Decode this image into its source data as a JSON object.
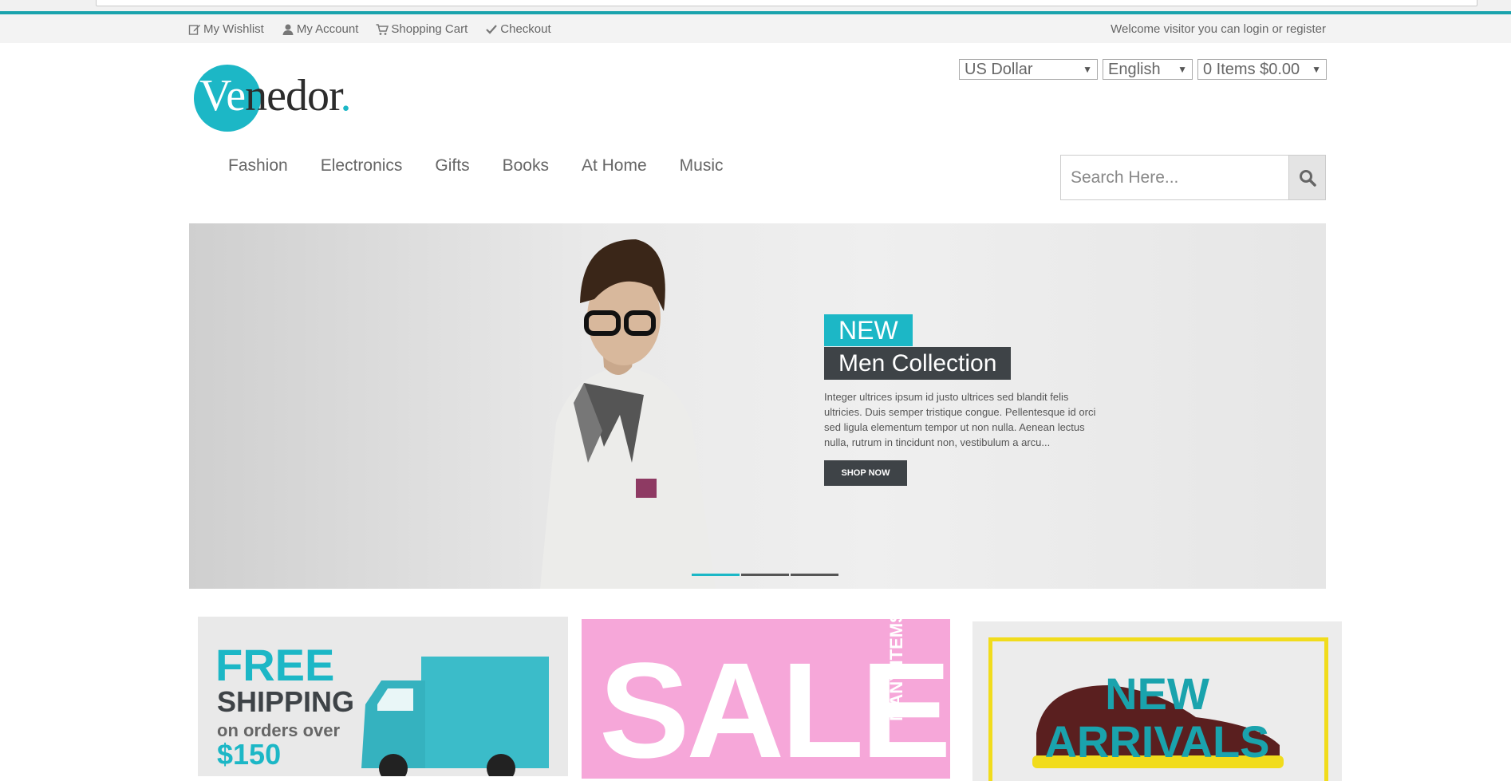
{
  "toplinks": {
    "wishlist": "My Wishlist",
    "account": "My Account",
    "cart": "Shopping Cart",
    "checkout": "Checkout"
  },
  "welcome": "Welcome visitor you can login or register",
  "logo": {
    "ve": "Ve",
    "rest": "nedor",
    "dot": "."
  },
  "selects": {
    "currency": "US Dollar",
    "language": "English",
    "cart": "0 Items $0.00"
  },
  "nav": [
    "Fashion",
    "Electronics",
    "Gifts",
    "Books",
    "At Home",
    "Music"
  ],
  "search": {
    "placeholder": "Search Here..."
  },
  "hero": {
    "badge1": "NEW",
    "badge2": "Men Collection",
    "text": "Integer ultrices ipsum id justo ultrices sed blandit felis ultricies. Duis semper tristique congue. Pellentesque id orci sed ligula elementum tempor ut non nulla. Aenean lectus nulla, rutrum in tincidunt non, vestibulum a arcu...",
    "button": "SHOP NOW",
    "active_slide": 1,
    "slide_count": 3
  },
  "banners": {
    "free": "FREE",
    "shipping": "SHIPPING",
    "orders": "on orders over",
    "amount": "$150",
    "sale": "SALE",
    "many": "MANY ITEMS",
    "new": "NEW",
    "arrivals": "ARRIVALS"
  },
  "colors": {
    "accent": "#1cb7c6",
    "dark": "#3e4347",
    "pink": "#f6a7d9",
    "yellow": "#f1dc1c"
  }
}
